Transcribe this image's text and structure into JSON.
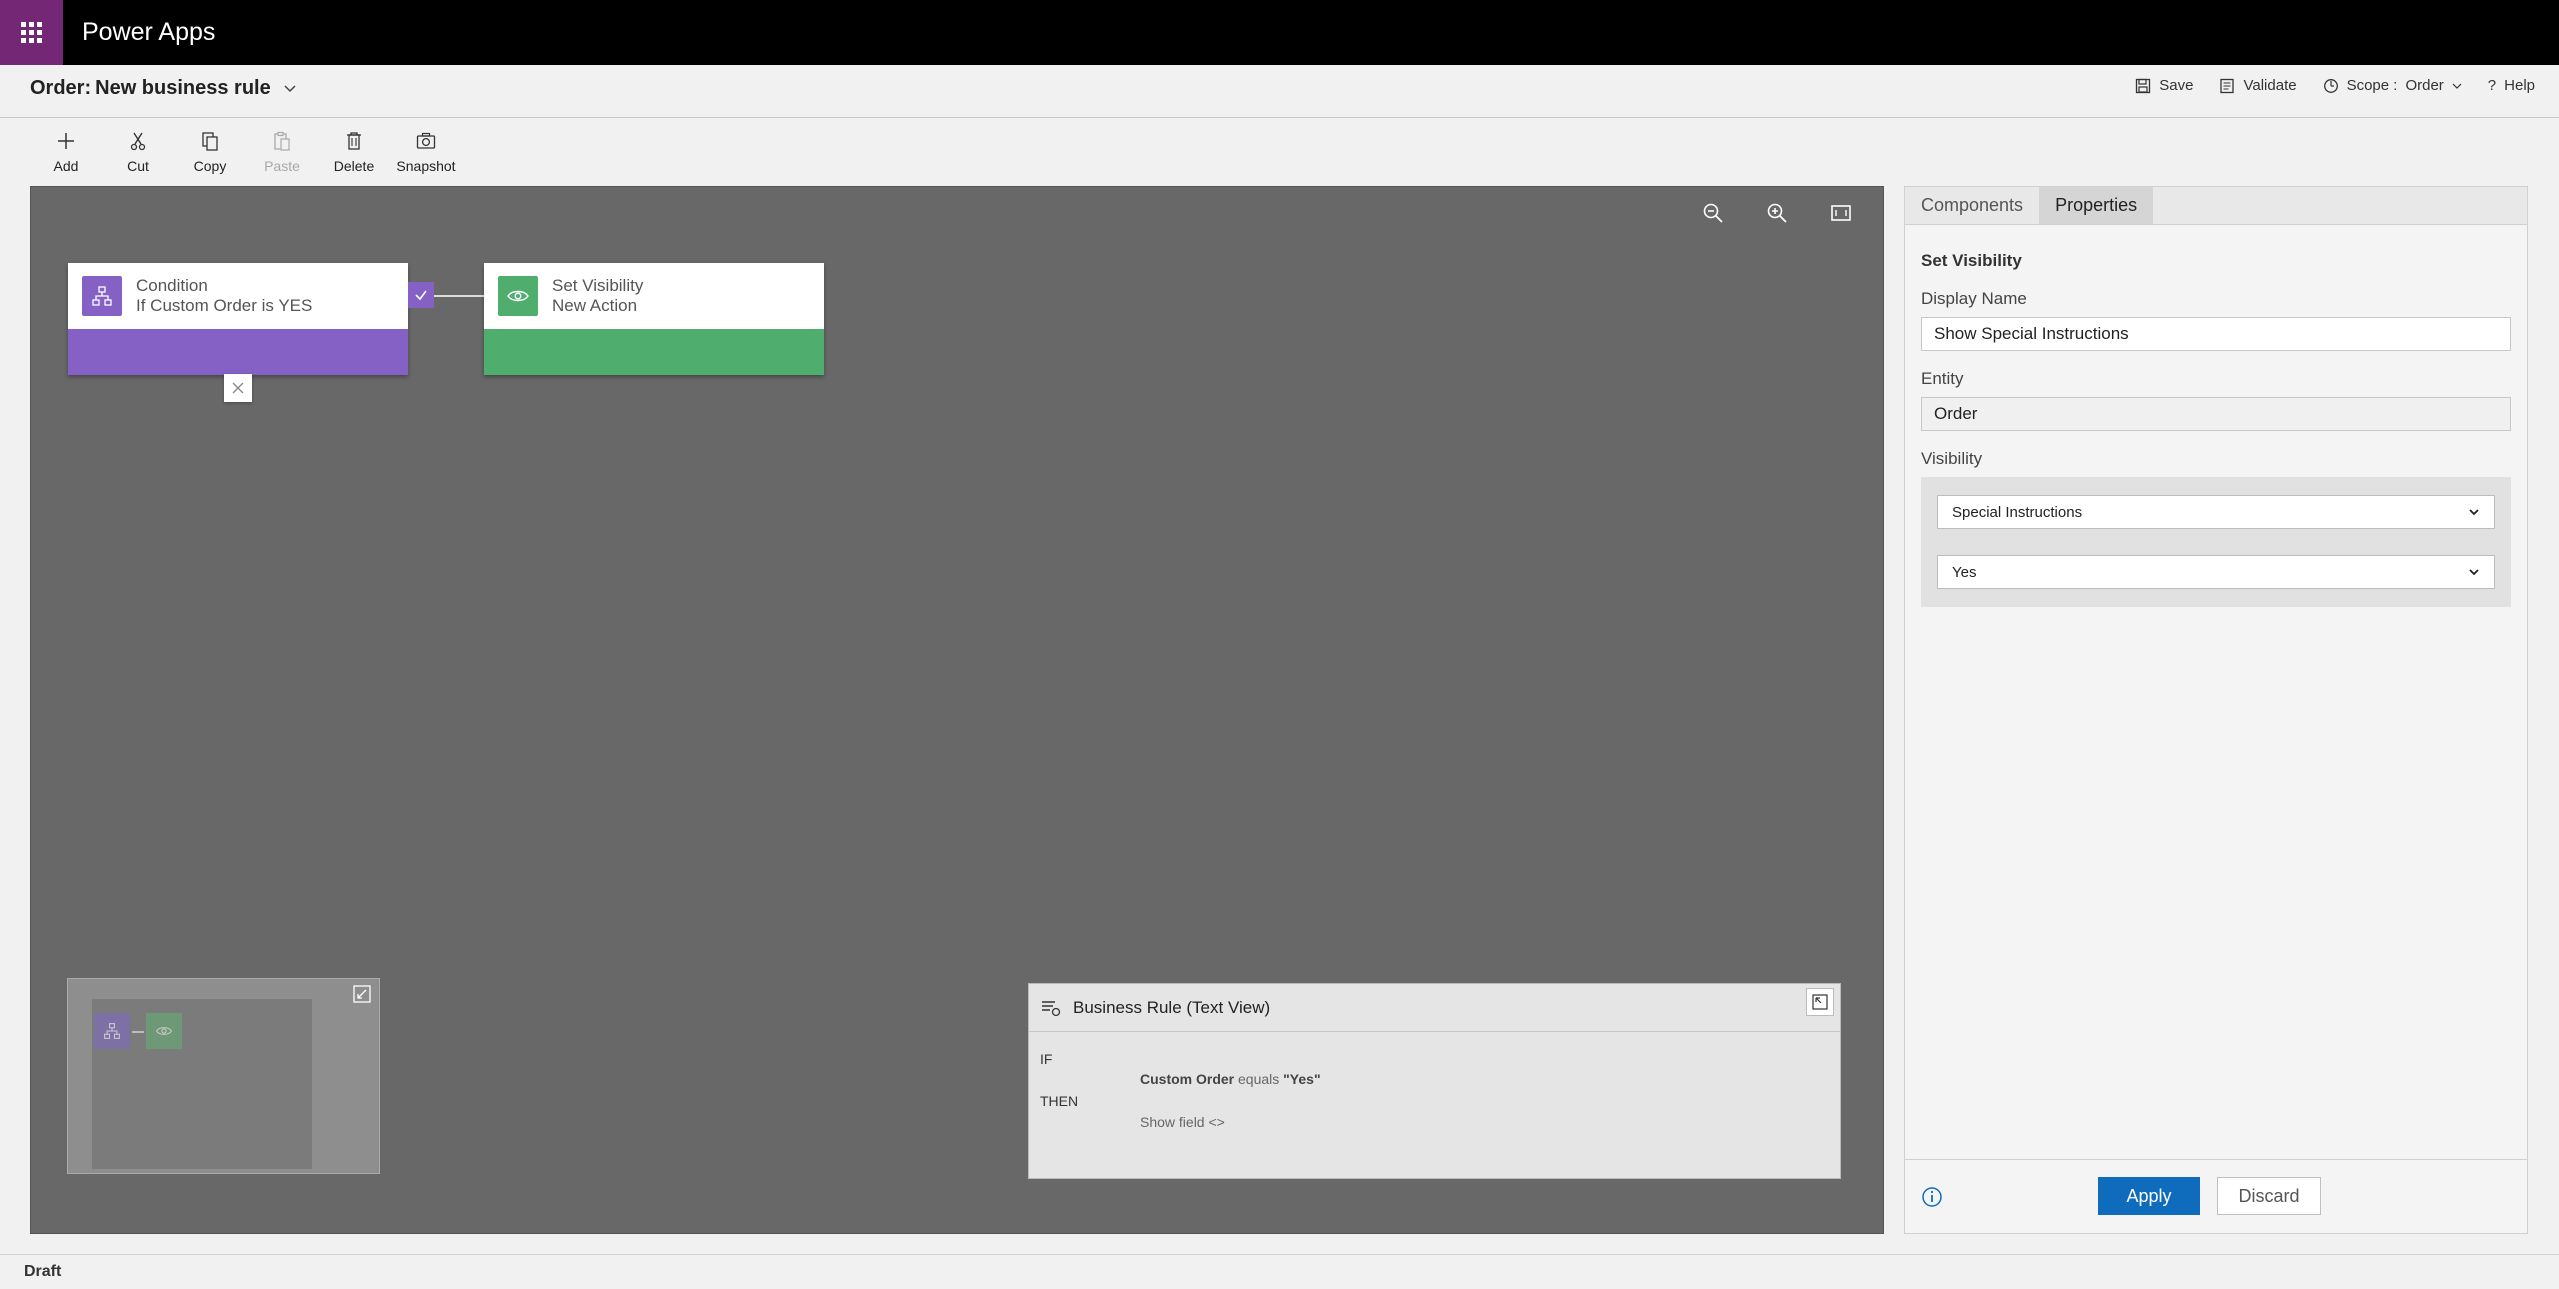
{
  "app": {
    "title": "Power Apps"
  },
  "header": {
    "entity": "Order:",
    "rule_name": "New business rule",
    "actions": {
      "save": "Save",
      "validate": "Validate",
      "scope_label": "Scope :",
      "scope_value": "Order",
      "help": "Help"
    }
  },
  "toolbar": {
    "add": "Add",
    "cut": "Cut",
    "copy": "Copy",
    "paste": "Paste",
    "delete": "Delete",
    "snapshot": "Snapshot"
  },
  "canvas": {
    "condition": {
      "type": "Condition",
      "label": "If Custom Order is YES"
    },
    "action": {
      "type": "Set Visibility",
      "label": "New Action"
    }
  },
  "text_view": {
    "title": "Business Rule (Text View)",
    "if": "IF",
    "then": "THEN",
    "cond_field": "Custom Order",
    "cond_op": "equals",
    "cond_value": "\"Yes\"",
    "then_text": "Show field <>"
  },
  "panel": {
    "tabs": [
      "Components",
      "Properties"
    ],
    "section": "Set Visibility",
    "display_name_label": "Display Name",
    "display_name": "Show Special Instructions",
    "entity_label": "Entity",
    "entity": "Order",
    "visibility_label": "Visibility",
    "field": "Special Instructions",
    "value": "Yes",
    "apply": "Apply",
    "discard": "Discard"
  },
  "colors": {
    "condition": "#8661c5",
    "action": "#4fae6d",
    "brand": "#742774",
    "apply": "#0f6cbd"
  },
  "status": {
    "text": "Draft"
  }
}
